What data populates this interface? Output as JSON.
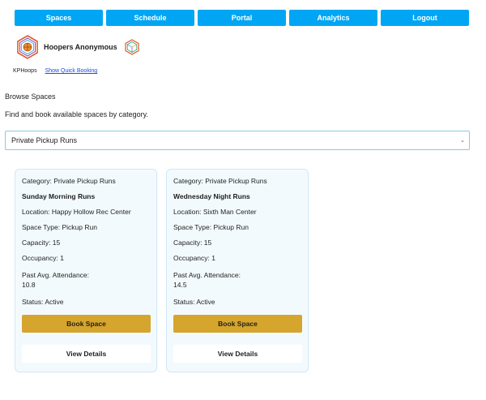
{
  "nav": {
    "items": [
      {
        "label": "Spaces"
      },
      {
        "label": "Schedule"
      },
      {
        "label": "Portal"
      },
      {
        "label": "Analytics"
      },
      {
        "label": "Logout"
      }
    ],
    "accent": "#00a6f4"
  },
  "brand": {
    "name": "Hoopers Anonymous",
    "logo_icon": "basketball-hexagon-logo",
    "secondary_icon": "hexagon-cube-icon"
  },
  "subline": {
    "user": "KPHoops",
    "quick_booking_link": "Show Quick Booking"
  },
  "page": {
    "title": "Browse Spaces",
    "description": "Find and book available spaces by category."
  },
  "category_select": {
    "selected": "Private Pickup Runs"
  },
  "cards": [
    {
      "category": "Category: Private Pickup Runs",
      "title": "Sunday Morning Runs",
      "location": "Location: Happy Hollow Rec Center",
      "space_type": "Space Type: Pickup Run",
      "capacity": "Capacity: 15",
      "occupancy": "Occupancy: 1",
      "attendance_label": "Past Avg. Attendance:",
      "attendance_value": "10.8",
      "status": "Status: Active",
      "book_label": "Book Space",
      "details_label": "View Details"
    },
    {
      "category": "Category: Private Pickup Runs",
      "title": "Wednesday Night Runs",
      "location": "Location: Sixth Man Center",
      "space_type": "Space Type: Pickup Run",
      "capacity": "Capacity: 15",
      "occupancy": "Occupancy: 1",
      "attendance_label": "Past Avg. Attendance:",
      "attendance_value": "14.5",
      "status": "Status: Active",
      "book_label": "Book Space",
      "details_label": "View Details"
    }
  ],
  "colors": {
    "book_button": "#d6a52d",
    "card_bg": "#f3fafe"
  }
}
